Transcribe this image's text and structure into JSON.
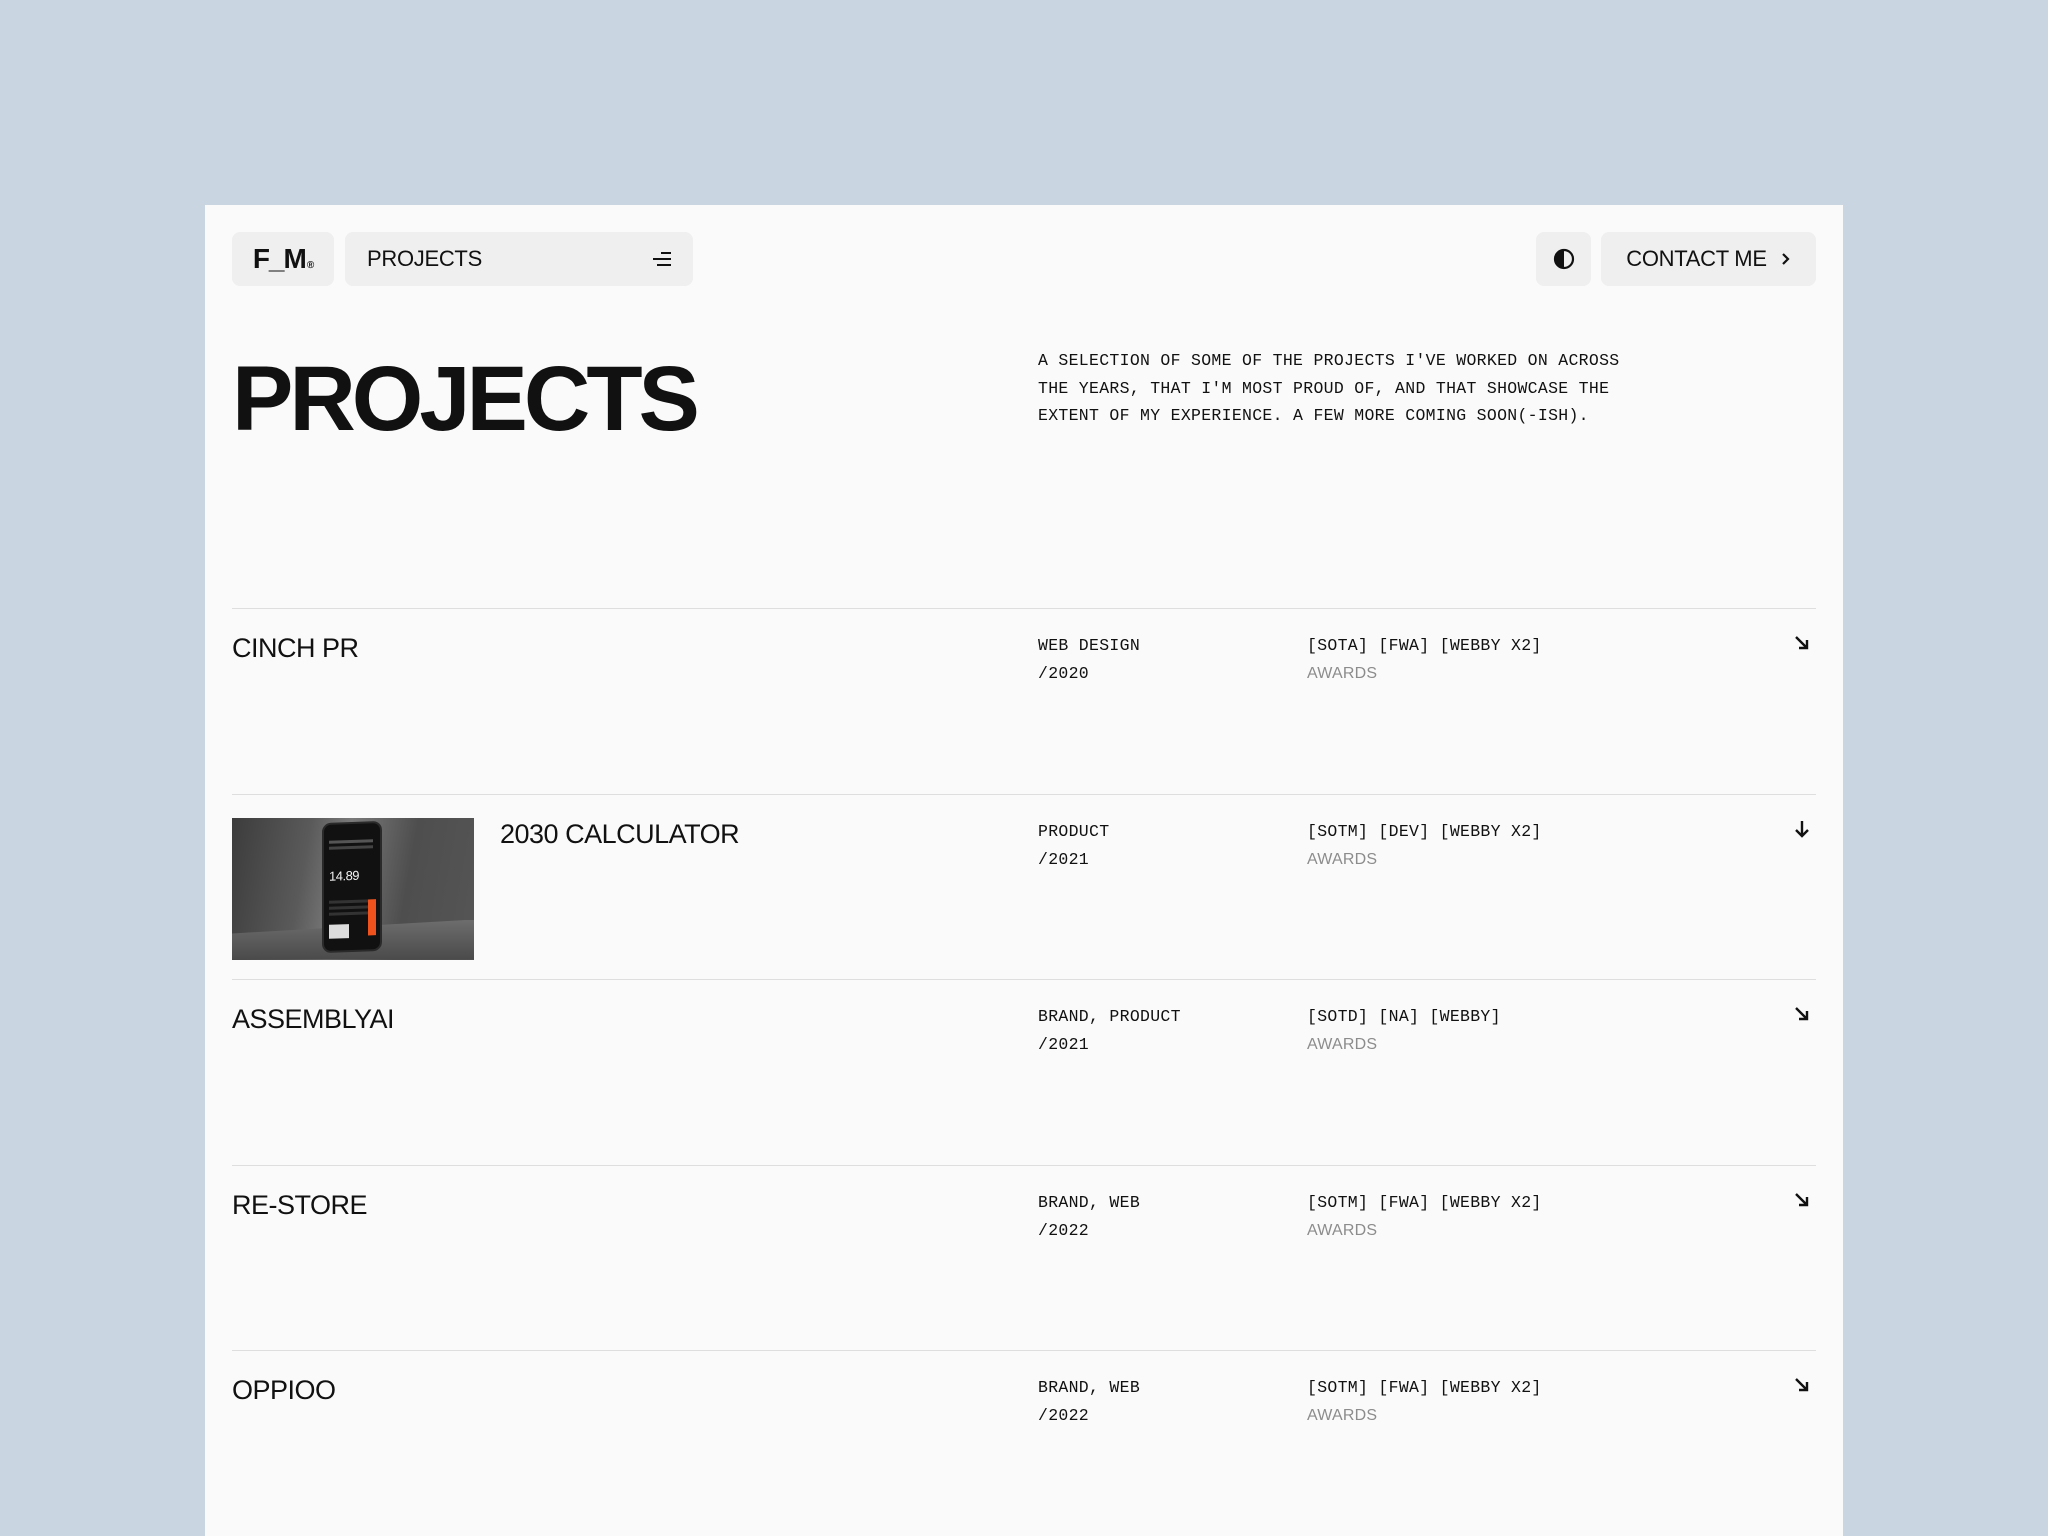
{
  "nav": {
    "logo": "F_M",
    "logo_mark": "®",
    "menu_label": "PROJECTS",
    "contact_label": "CONTACT ME"
  },
  "header": {
    "title": "PROJECTS",
    "intro_lines": [
      "A SELECTION OF SOME OF THE PROJECTS I'VE WORKED ON ACROSS",
      "THE YEARS, THAT I'M MOST PROUD OF, AND THAT SHOWCASE THE",
      "EXTENT OF MY EXPERIENCE. A FEW MORE COMING SOON(-ISH)."
    ]
  },
  "projects": [
    {
      "name": "CINCH PR",
      "category": "WEB DESIGN",
      "year": "/2020",
      "awards": "[SOTA] [FWA] [WEBBY X2]",
      "awards_label": "AWARDS",
      "arrow": "arrow-down-right"
    },
    {
      "name": "2030 CALCULATOR",
      "category": "PRODUCT",
      "year": "/2021",
      "awards": "[SOTM] [DEV] [WEBBY X2]",
      "awards_label": "AWARDS",
      "arrow": "arrow-down",
      "thumb_value": "14.89"
    },
    {
      "name": "ASSEMBLYAI",
      "category": "BRAND, PRODUCT",
      "year": "/2021",
      "awards": "[SOTD] [NA] [WEBBY]",
      "awards_label": "AWARDS",
      "arrow": "arrow-down-right"
    },
    {
      "name": "RE-STORE",
      "category": "BRAND, WEB",
      "year": "/2022",
      "awards": "[SOTM] [FWA] [WEBBY X2]",
      "awards_label": "AWARDS",
      "arrow": "arrow-down-right"
    },
    {
      "name": "OPPIOO",
      "category": "BRAND, WEB",
      "year": "/2022",
      "awards": "[SOTM] [FWA] [WEBBY X2]",
      "awards_label": "AWARDS",
      "arrow": "arrow-down-right"
    }
  ],
  "colors": {
    "background": "#c9d5e1",
    "page": "#fafafa",
    "pill": "#efefef",
    "accent": "#f0521e"
  }
}
